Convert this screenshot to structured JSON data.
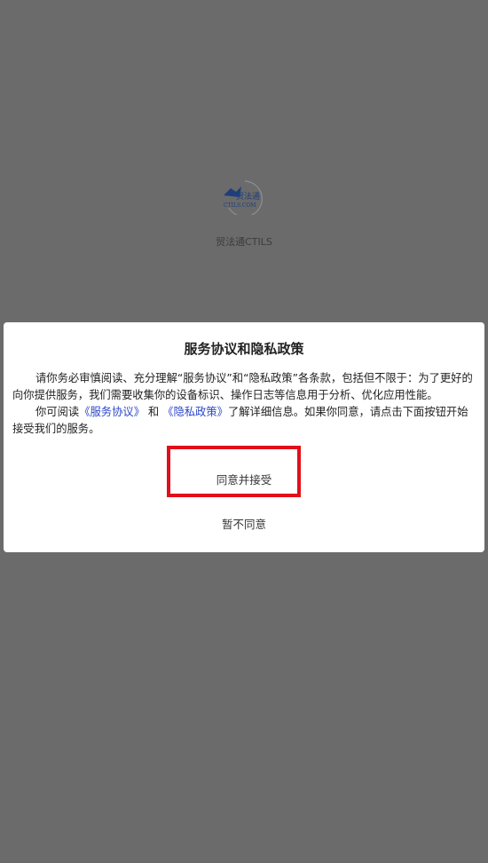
{
  "app": {
    "name": "贸法通CTILS",
    "logo_text_main": "贸法通",
    "logo_text_sub": "CTILS.COM"
  },
  "dialog": {
    "title": "服务协议和隐私政策",
    "paragraph1": "请你务必审慎阅读、充分理解“服务协议”和“隐私政策”各条款，包括但不限于：为了更好的向你提供服务，我们需要收集你的设备标识、操作日志等信息用于分析、优化应用性能。",
    "paragraph2_prefix": "你可阅读",
    "service_link": "《服务协议》",
    "paragraph2_and": "和",
    "privacy_link": "《隐私政策》",
    "paragraph2_suffix": "了解详细信息。如果你同意，请点击下面按钮开始接受我们的服务。",
    "agree_label": "同意并接受",
    "decline_label": "暂不同意"
  },
  "colors": {
    "backdrop": "#6b6b6b",
    "link": "#2b47c9",
    "highlight": "#e0101a"
  }
}
